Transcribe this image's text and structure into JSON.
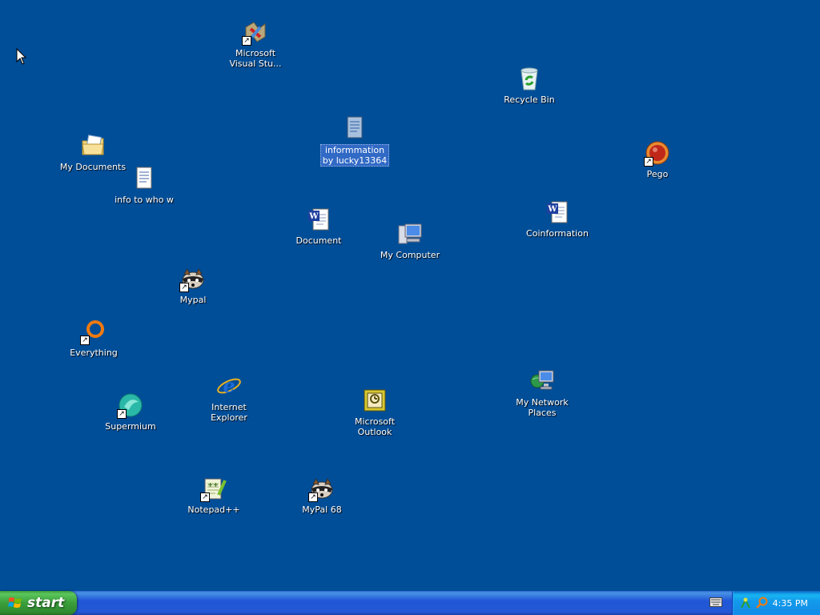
{
  "desktop": {
    "background_color": "#004e98",
    "icons": {
      "visual_studio": {
        "label": "Microsoft\nVisual Stu...",
        "icon": "visual-studio-icon",
        "shortcut": true
      },
      "recycle_bin": {
        "label": "Recycle Bin",
        "icon": "recycle-bin-icon",
        "shortcut": false
      },
      "my_documents": {
        "label": "My Documents",
        "icon": "my-documents-icon",
        "shortcut": false
      },
      "info_to_who": {
        "label": "info to who w",
        "icon": "text-document-icon",
        "shortcut": false
      },
      "information": {
        "label": "informmation\nby lucky13364",
        "icon": "text-document-icon",
        "shortcut": false,
        "selected": true
      },
      "pego": {
        "label": "Pego",
        "icon": "pego-icon",
        "shortcut": true
      },
      "document": {
        "label": "Document",
        "icon": "word-document-icon",
        "shortcut": false
      },
      "my_computer": {
        "label": "My Computer",
        "icon": "my-computer-icon",
        "shortcut": false
      },
      "coinformation": {
        "label": "Coinformation",
        "icon": "word-document-icon",
        "shortcut": false
      },
      "mypal": {
        "label": "Mypal",
        "icon": "mypal-raccoon-icon",
        "shortcut": true
      },
      "everything": {
        "label": "Everything",
        "icon": "everything-search-icon",
        "shortcut": true
      },
      "supermium": {
        "label": "Supermium",
        "icon": "supermium-icon",
        "shortcut": true
      },
      "internet_explorer": {
        "label": "Internet\nExplorer",
        "icon": "internet-explorer-icon",
        "shortcut": false
      },
      "outlook": {
        "label": "Microsoft\nOutlook",
        "icon": "outlook-icon",
        "shortcut": false
      },
      "my_network_places": {
        "label": "My Network\nPlaces",
        "icon": "network-places-icon",
        "shortcut": false
      },
      "notepadpp": {
        "label": "Notepad++",
        "icon": "notepad-plus-plus-icon",
        "shortcut": true
      },
      "mypal68": {
        "label": "MyPal 68",
        "icon": "mypal-raccoon-icon",
        "shortcut": true
      }
    }
  },
  "taskbar": {
    "start_label": "start",
    "clock": "4:35 PM",
    "tray_icons": [
      "network-tray-icon",
      "search-tray-icon"
    ],
    "keyboard_indicator": "keyboard-icon"
  }
}
